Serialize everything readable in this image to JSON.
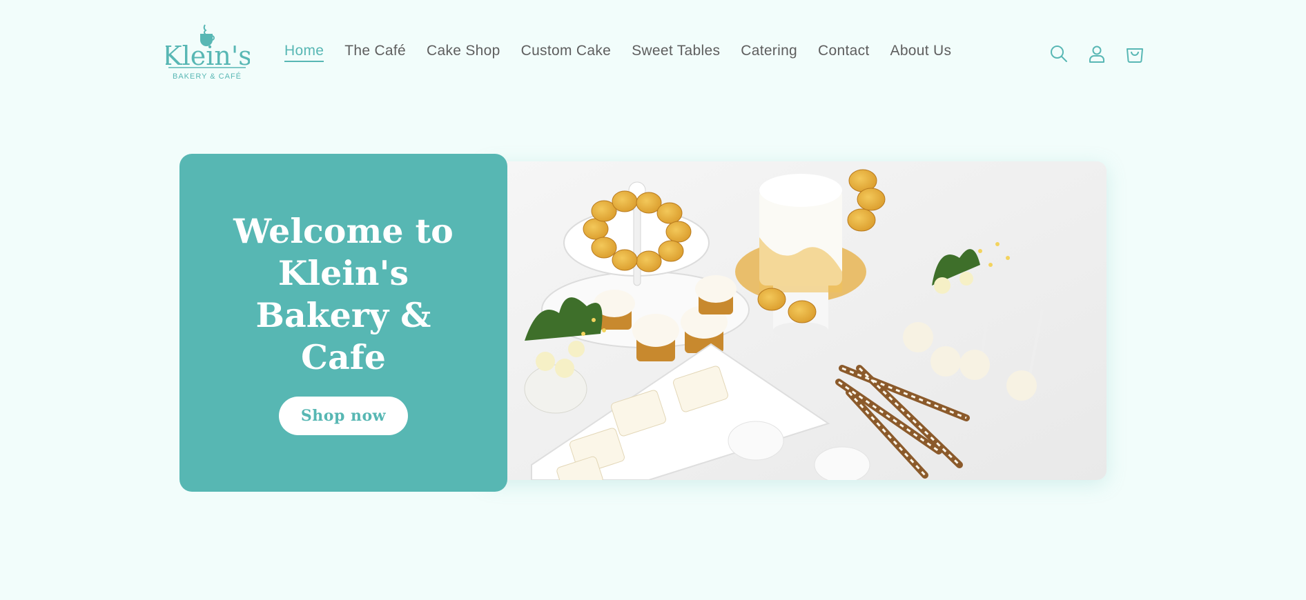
{
  "brand": {
    "name": "Klein's",
    "tagline": "BAKERY & CAFÉ",
    "color": "#58b7b4"
  },
  "nav": {
    "items": [
      {
        "label": "Home",
        "active": true
      },
      {
        "label": "The Café"
      },
      {
        "label": "Cake Shop"
      },
      {
        "label": "Custom Cake"
      },
      {
        "label": "Sweet Tables"
      },
      {
        "label": "Catering"
      },
      {
        "label": "Contact"
      },
      {
        "label": "About Us"
      }
    ]
  },
  "header_icons": [
    "search-icon",
    "account-icon",
    "cart-icon"
  ],
  "hero": {
    "title": "Welcome to Klein's Bakery & Cafe",
    "button_label": "Shop now",
    "card_color": "#57b7b3",
    "image": "dessert-table-photo"
  },
  "colors": {
    "background": "#f2fdfb",
    "accent": "#57b7b3",
    "nav_text": "#5e5e5e"
  }
}
